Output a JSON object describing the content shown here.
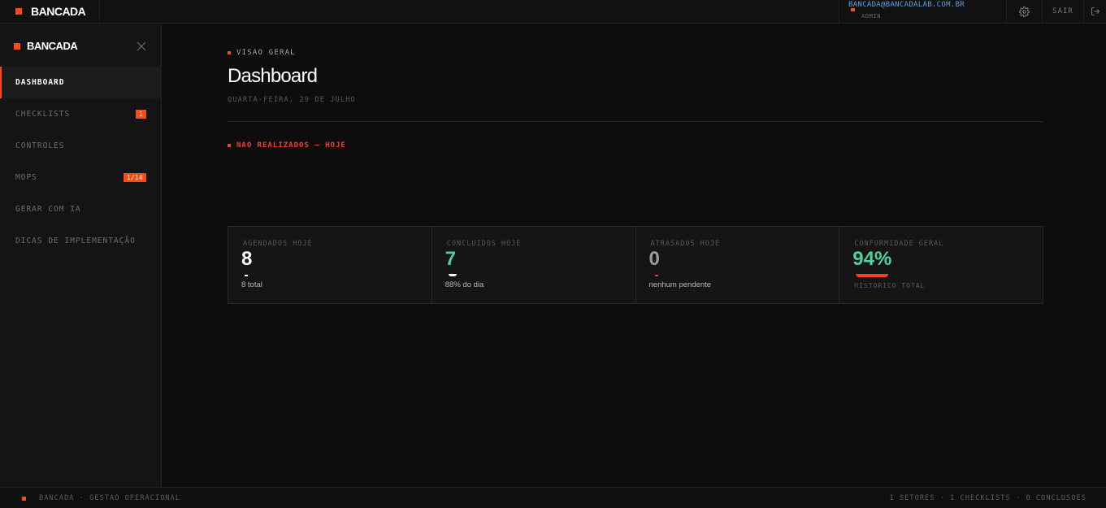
{
  "topbar": {
    "brand": "BANCADA",
    "user_email": "BANCADA@BANCADALAB.COM.BR",
    "user_role": "ADMIN",
    "logout_label": "SAIR"
  },
  "sidebar": {
    "title": "BANCADA",
    "items": [
      {
        "label": "DASHBOARD",
        "badge": "",
        "active": true
      },
      {
        "label": "CHECKLISTS",
        "badge": "1"
      },
      {
        "label": "CONTROLES",
        "badge": ""
      },
      {
        "label": "MOPS",
        "badge": "1/14"
      },
      {
        "label": "GERAR COM IA",
        "badge": ""
      },
      {
        "label": "DICAS DE IMPLEMENTAÇÃO",
        "badge": ""
      }
    ]
  },
  "main": {
    "eyebrow": "VISAO GERAL",
    "title": "Dashboard",
    "date": "QUARTA-FEIRA, 29 DE JULHO",
    "alert_heading": "NAO REALIZADOS — HOJE",
    "stats": [
      {
        "label": "AGENDADOS HOJE",
        "value": "8",
        "sub": "8 total"
      },
      {
        "label": "CONCLUIDOS HOJE",
        "value": "7",
        "sub": "88% do dia"
      },
      {
        "label": "ATRASADOS HOJE",
        "value": "0",
        "sub": "nenhum pendente"
      },
      {
        "label": "CONFORMIDADE GERAL",
        "value": "94%",
        "sub": "HISTORICO TOTAL"
      }
    ]
  },
  "footer": {
    "left": "BANCADA · GESTAO OPERACIONAL",
    "right": "1 SETORES · 1 CHECKLISTS · 0 CONCLUSOES"
  },
  "colors": {
    "accent": "#ff4a12",
    "success": "#4ed19a",
    "danger": "#ff3c2a",
    "link": "#5aa0e6"
  }
}
